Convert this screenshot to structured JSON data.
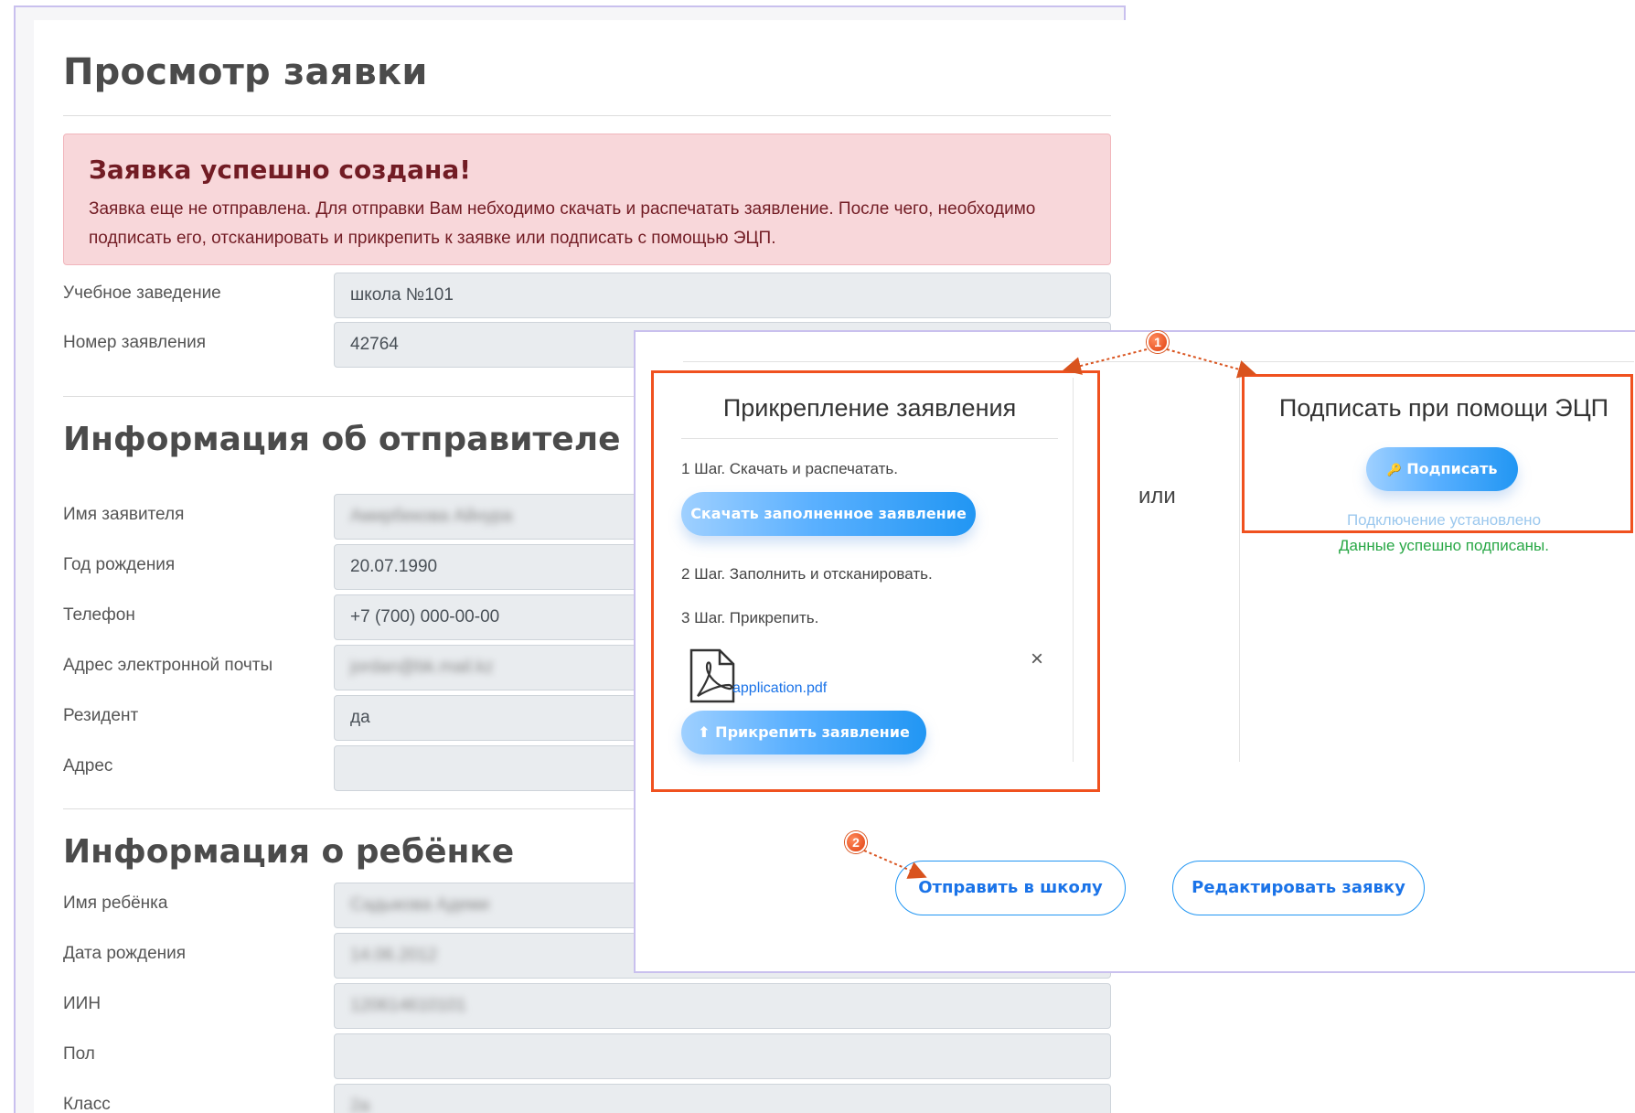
{
  "page": {
    "title": "Просмотр заявки",
    "alert": {
      "title": "Заявка успешно создана!",
      "text": "Заявка еще не отправлена. Для отправки Вам небходимо скачать и распечатать заявление. После чего, необходимо подписать его, отсканировать и прикрепить к заявке или подписать с помощью ЭЦП."
    },
    "rows": [
      {
        "label": "Учебное заведение",
        "value": "школа №101"
      },
      {
        "label": "Номер заявления",
        "value": "42764"
      }
    ],
    "sender": {
      "title": "Информация об отправителе",
      "rows": [
        {
          "label": "Имя заявителя",
          "value": "Амирбекова Айнура"
        },
        {
          "label": "Год рождения",
          "value": "20.07.1990"
        },
        {
          "label": "Телефон",
          "value": "+7 (700) 000-00-00"
        },
        {
          "label": "Адрес электронной почты",
          "value": "jordan@bk.mail.kz"
        },
        {
          "label": "Резидент",
          "value": "да"
        },
        {
          "label": "Адрес",
          "value": ""
        }
      ]
    },
    "child": {
      "title": "Информация о ребёнке",
      "rows": [
        {
          "label": "Имя ребёнка",
          "value": "Садыкова Адеми"
        },
        {
          "label": "Дата рождения",
          "value": "14.06.2012"
        },
        {
          "label": "ИИН",
          "value": "120614610101"
        },
        {
          "label": "Пол",
          "value": ""
        },
        {
          "label": "Класс",
          "value": "2а"
        }
      ]
    }
  },
  "dialog": {
    "attach": {
      "title": "Прикрепление заявления",
      "step1": "1 Шаг. Скачать и распечатать.",
      "download_button": "Скачать заполненное заявление",
      "step2": "2 Шаг. Заполнить и отсканировать.",
      "step3": "3 Шаг. Прикрепить.",
      "file_name": "application.pdf",
      "remove_symbol": "×",
      "attach_button": "Прикрепить заявление",
      "attach_icon": "⬆"
    },
    "or_text": "или",
    "sign": {
      "title": "Подписать при помощи ЭЦП",
      "sign_button": "Подписать",
      "sign_icon": "🔑",
      "connection_status": "Подключение установлено",
      "signed_status": "Данные успешно подписаны."
    },
    "send_button": "Отправить в школу",
    "edit_button": "Редактировать заявку"
  },
  "callouts": {
    "marker1": "1",
    "marker2": "2",
    "color": "#f0511f"
  }
}
